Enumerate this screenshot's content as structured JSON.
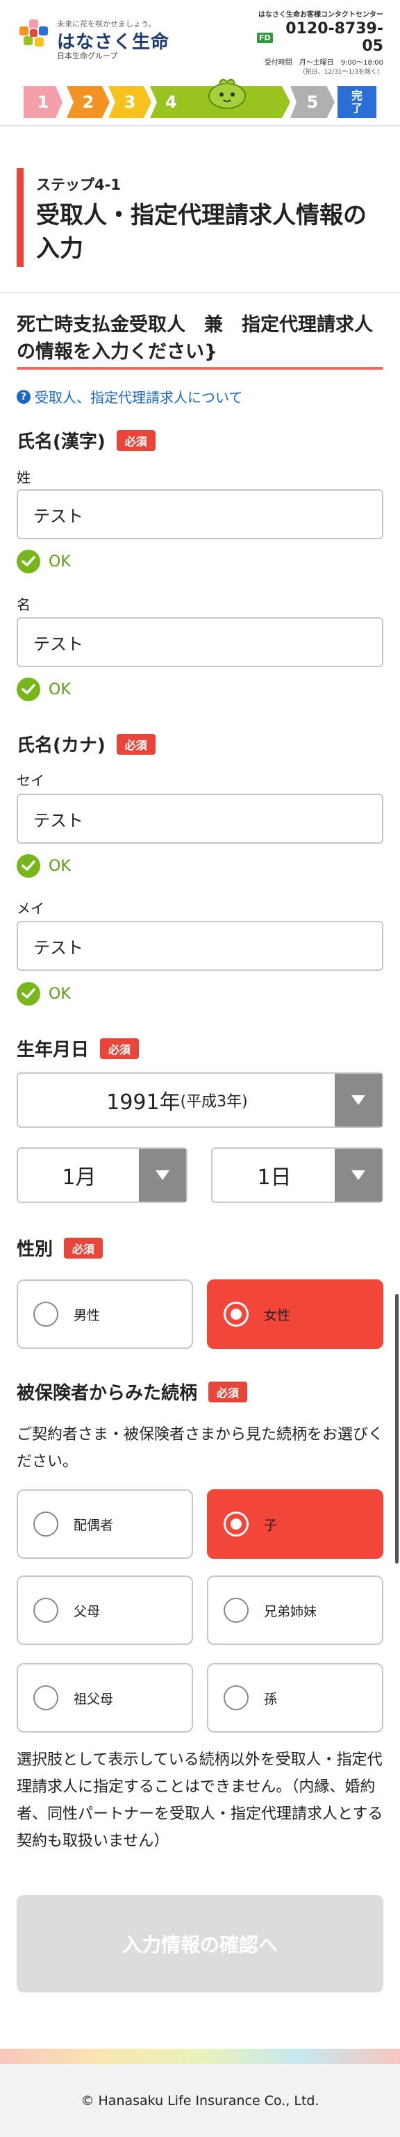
{
  "header": {
    "tagline": "未来に花を咲かせましょう。",
    "company_name": "はなさく生命",
    "group": "日本生命グループ",
    "contact_title": "はなさく生命お客様コンタクトセンター",
    "freedial_badge": "FD",
    "phone": "0120-8739-05",
    "hours": "受付時間　月〜土曜日　9:00〜18:00",
    "note": "（祝日、12/31〜1/3を除く）"
  },
  "steps": [
    {
      "label": "1",
      "color": "#f3a0a8"
    },
    {
      "label": "2",
      "color": "#f39323"
    },
    {
      "label": "3",
      "color": "#f7c21e"
    },
    {
      "label": "4",
      "color": "#9ac31f"
    },
    {
      "label": "5",
      "color": "#b0b0b0"
    },
    {
      "label": "完了",
      "color": "#2a6fd6"
    }
  ],
  "step_label": "ステップ4-1",
  "page_title": "受取人・指定代理請求人情報の入力",
  "section_heading": "死亡時支払金受取人　兼　指定代理請求人の情報を入力ください}",
  "help_link": "受取人、指定代理請求人について",
  "required_label": "必須",
  "ok_label": "OK",
  "name_kanji": {
    "label": "氏名(漢字)",
    "sei_label": "姓",
    "sei_value": "テスト",
    "mei_label": "名",
    "mei_value": "テスト"
  },
  "name_kana": {
    "label": "氏名(カナ)",
    "sei_label": "セイ",
    "sei_value": "テスト",
    "mei_label": "メイ",
    "mei_value": "テスト"
  },
  "birthdate": {
    "label": "生年月日",
    "year_value": "1991年",
    "year_era": "(平成3年)",
    "month_value": "1月",
    "day_value": "1日"
  },
  "gender": {
    "label": "性別",
    "options": [
      {
        "label": "男性",
        "selected": false
      },
      {
        "label": "女性",
        "selected": true
      }
    ]
  },
  "relationship": {
    "label": "被保険者からみた続柄",
    "instruction": "ご契約者さま・被保険者さまから見た続柄をお選びください。",
    "options": [
      {
        "label": "配偶者",
        "selected": false
      },
      {
        "label": "子",
        "selected": true
      },
      {
        "label": "父母",
        "selected": false
      },
      {
        "label": "兄弟姉妹",
        "selected": false
      },
      {
        "label": "祖父母",
        "selected": false
      },
      {
        "label": "孫",
        "selected": false
      }
    ],
    "note": "選択肢として表示している続柄以外を受取人・指定代理請求人に指定することはできません。（内縁、婚約者、同性パートナーを受取人・指定代理請求人とする契約も取扱いません）"
  },
  "submit_label": "入力情報の確認へ",
  "footer": "© Hanasaku Life Insurance Co., Ltd."
}
